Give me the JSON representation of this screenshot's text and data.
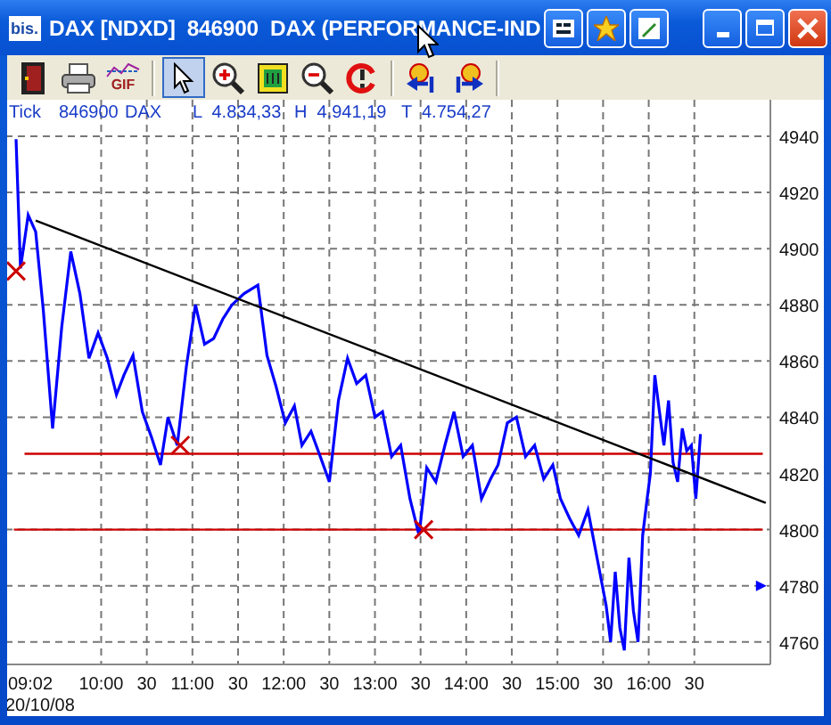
{
  "window": {
    "app_icon": "bis.",
    "title": "DAX [NDXD]  846900  DAX (PERFORMANCE-IND"
  },
  "title_tools": [
    {
      "kind": "list"
    },
    {
      "kind": "star"
    },
    {
      "kind": "edit"
    }
  ],
  "toolbar": [
    {
      "kind": "exit",
      "selected": false,
      "separator_before": false
    },
    {
      "kind": "print",
      "selected": false,
      "separator_before": false
    },
    {
      "kind": "gif",
      "label": "GIF",
      "selected": false,
      "separator_before": false
    },
    {
      "kind": "pointer",
      "selected": true,
      "separator_before": true
    },
    {
      "kind": "zoom-in",
      "selected": false,
      "separator_before": false
    },
    {
      "kind": "fit",
      "selected": false,
      "separator_before": false
    },
    {
      "kind": "zoom-out",
      "selected": false,
      "separator_before": false
    },
    {
      "kind": "reset",
      "selected": false,
      "separator_before": false
    },
    {
      "kind": "scroll-left",
      "selected": false,
      "separator_before": true
    },
    {
      "kind": "scroll-right",
      "selected": false,
      "separator_before": false
    }
  ],
  "chart": {
    "info": [
      "Tick",
      "846900",
      "DAX",
      "L  4.834,33",
      "H  4.941,19",
      "T  4.754,27"
    ],
    "date": "20/10/08",
    "half_hour_labels": [
      "30",
      "30",
      "30",
      "30",
      "30",
      "30",
      "30"
    ],
    "chart_data": {
      "type": "line",
      "x": [
        9.067,
        9.117,
        9.2,
        9.283,
        9.367,
        9.467,
        9.567,
        9.667,
        9.767,
        9.867,
        9.967,
        10.067,
        10.167,
        10.25,
        10.35,
        10.45,
        10.55,
        10.65,
        10.733,
        10.833,
        10.933,
        11.033,
        11.133,
        11.233,
        11.333,
        11.433,
        11.567,
        11.717,
        11.817,
        11.917,
        12.017,
        12.117,
        12.2,
        12.3,
        12.4,
        12.5,
        12.6,
        12.7,
        12.8,
        12.9,
        13,
        13.083,
        13.183,
        13.283,
        13.383,
        13.483,
        13.567,
        13.667,
        13.767,
        13.867,
        13.967,
        14.067,
        14.167,
        14.267,
        14.35,
        14.45,
        14.55,
        14.65,
        14.75,
        14.85,
        14.95,
        15.033,
        15.133,
        15.233,
        15.333,
        15.433,
        15.533,
        15.583,
        15.633,
        15.683,
        15.733,
        15.783,
        15.833,
        15.883,
        15.933,
        15.983,
        16.017,
        16.067,
        16.117,
        16.167,
        16.217,
        16.267,
        16.317,
        16.367,
        16.417,
        16.467,
        16.517,
        16.567,
        17.283
      ],
      "series": [
        {
          "color": "#0000ff",
          "values": [
            4939,
            4893,
            4912,
            4906,
            4878,
            4836,
            4872,
            4899,
            4884,
            4861,
            4870,
            4861,
            4848,
            4855,
            4862,
            4842,
            4833,
            4823,
            4840,
            4830,
            4858,
            4880,
            4866,
            4868,
            4875,
            4880,
            4884,
            4887,
            4862,
            4851,
            4838,
            4844,
            4830,
            4835,
            4826,
            4817,
            4846,
            4861,
            4852,
            4855,
            4840,
            4842,
            4826,
            4830,
            4811,
            4798,
            4822,
            4817,
            4830,
            4842,
            4826,
            4830,
            4811,
            4818,
            4823,
            4838,
            4840,
            4826,
            4830,
            4818,
            4823,
            4811,
            4804,
            4798,
            4807,
            4790,
            4773,
            4760,
            4785,
            4765,
            4757,
            4790,
            4771,
            4760,
            4798,
            4811,
            4820,
            4855,
            4842,
            4830,
            4846,
            4824,
            4817,
            4836,
            4828,
            4830,
            4811,
            4834,
            null
          ]
        },
        {
          "color": "#000000",
          "values": [
            null,
            null,
            null,
            4910,
            null,
            null,
            null,
            null,
            null,
            null,
            null,
            null,
            null,
            null,
            null,
            null,
            null,
            null,
            null,
            null,
            null,
            null,
            null,
            null,
            null,
            null,
            null,
            null,
            null,
            null,
            null,
            null,
            null,
            null,
            null,
            null,
            null,
            null,
            null,
            null,
            null,
            null,
            null,
            null,
            null,
            null,
            null,
            null,
            null,
            null,
            null,
            null,
            null,
            null,
            null,
            null,
            null,
            null,
            null,
            null,
            null,
            null,
            null,
            null,
            null,
            null,
            null,
            null,
            null,
            null,
            null,
            null,
            null,
            null,
            null,
            null,
            null,
            null,
            null,
            null,
            null,
            null,
            null,
            null,
            null,
            null,
            null,
            null,
            4809.5
          ]
        }
      ],
      "xlim": [
        8.95,
        17.333
      ],
      "ylim": [
        4752,
        4953
      ],
      "xticks": [
        {
          "value": 9.033,
          "label": "09:02"
        },
        {
          "value": 10,
          "label": "10:00"
        },
        {
          "value": 11,
          "label": "11:00"
        },
        {
          "value": 12,
          "label": "12:00"
        },
        {
          "value": 13,
          "label": "13:00"
        },
        {
          "value": 14,
          "label": "14:00"
        },
        {
          "value": 15,
          "label": "15:00"
        },
        {
          "value": 16,
          "label": "16:00"
        }
      ],
      "yticks": [
        4760,
        4780,
        4800,
        4820,
        4840,
        4860,
        4880,
        4900,
        4920,
        4940
      ],
      "grid": true,
      "ref_lines": [
        {
          "axis": "y",
          "value": 4827,
          "color": "#cc0000"
        },
        {
          "axis": "y",
          "value": 4800,
          "color": "#cc0000"
        }
      ]
    }
  }
}
